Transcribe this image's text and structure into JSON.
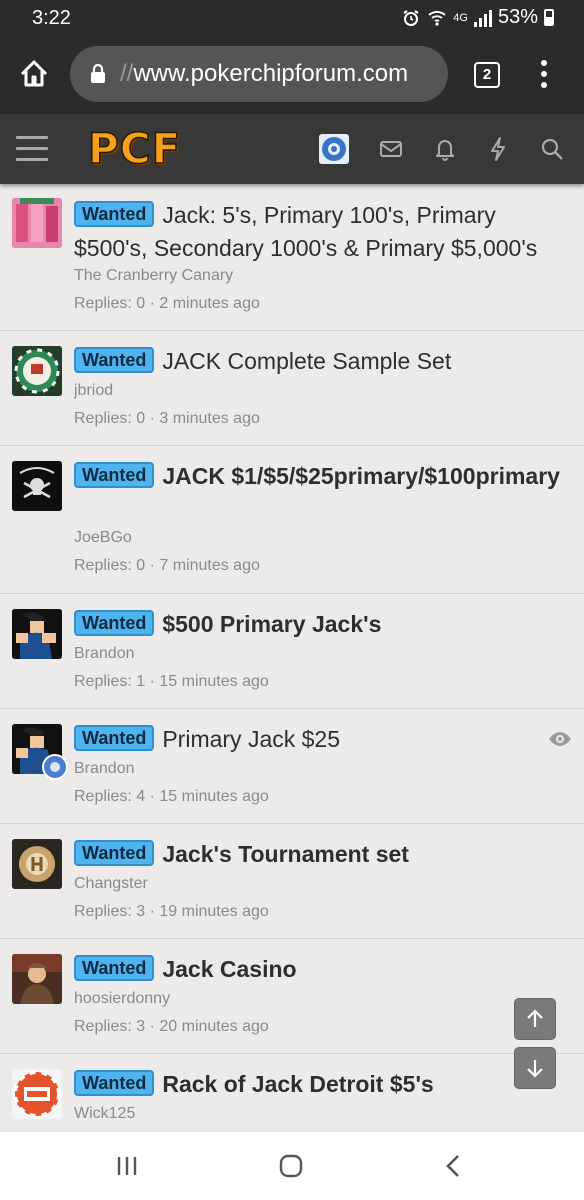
{
  "status_bar": {
    "time": "3:22",
    "network": "4G",
    "battery": "53%"
  },
  "browser": {
    "url_scheme": "//",
    "url_host": "www.pokerchipforum.com",
    "tab_count": "2"
  },
  "forum": {
    "logo": "PCF"
  },
  "threads": [
    {
      "prefix": "Wanted",
      "title": "Jack: 5's, Primary 100's, Primary $500's, Secondary 1000's & Primary $5,000's",
      "author": "The Cranberry Canary",
      "meta": "Replies: 0 · 2 minutes ago",
      "bold": false
    },
    {
      "prefix": "Wanted",
      "title": "JACK Complete Sample Set",
      "author": "jbriod",
      "meta": "Replies: 0 · 3 minutes ago",
      "bold": false
    },
    {
      "prefix": "Wanted",
      "title": "JACK $1/$5/$25primary/$100primary",
      "author": "JoeBGo",
      "meta": "Replies: 0 · 7 minutes ago",
      "bold": true
    },
    {
      "prefix": "Wanted",
      "title": "$500 Primary Jack's",
      "author": "Brandon",
      "meta": "Replies: 1 · 15 minutes ago",
      "bold": true
    },
    {
      "prefix": "Wanted",
      "title": "Primary Jack $25",
      "author": "Brandon",
      "meta": "Replies: 4 · 15 minutes ago",
      "bold": false
    },
    {
      "prefix": "Wanted",
      "title": "Jack's Tournament set",
      "author": "Changster",
      "meta": "Replies: 3 · 19 minutes ago",
      "bold": true
    },
    {
      "prefix": "Wanted",
      "title": "Jack Casino",
      "author": "hoosierdonny",
      "meta": "Replies: 3 · 20 minutes ago",
      "bold": true
    },
    {
      "prefix": "Wanted",
      "title": "Rack of Jack Detroit $5's",
      "author": "Wick125",
      "meta": "",
      "bold": true
    }
  ],
  "icons": {
    "status": [
      "alarm-icon",
      "wifi-icon",
      "signal-icon",
      "battery-icon"
    ],
    "browser": [
      "home-icon",
      "lock-icon",
      "tabs-icon",
      "overflow-menu-icon"
    ],
    "forum": [
      "menu-icon",
      "user-avatar",
      "inbox-icon",
      "bell-icon",
      "whats-new-icon",
      "search-icon"
    ],
    "scroll": [
      "arrow-up-icon",
      "arrow-down-icon"
    ],
    "nav": [
      "recent-apps-icon",
      "home-nav-icon",
      "back-icon"
    ]
  },
  "colors": {
    "badge": "#4fb3ee",
    "logo": "#f6a11b",
    "header": "#383838",
    "background": "#ecebea"
  }
}
